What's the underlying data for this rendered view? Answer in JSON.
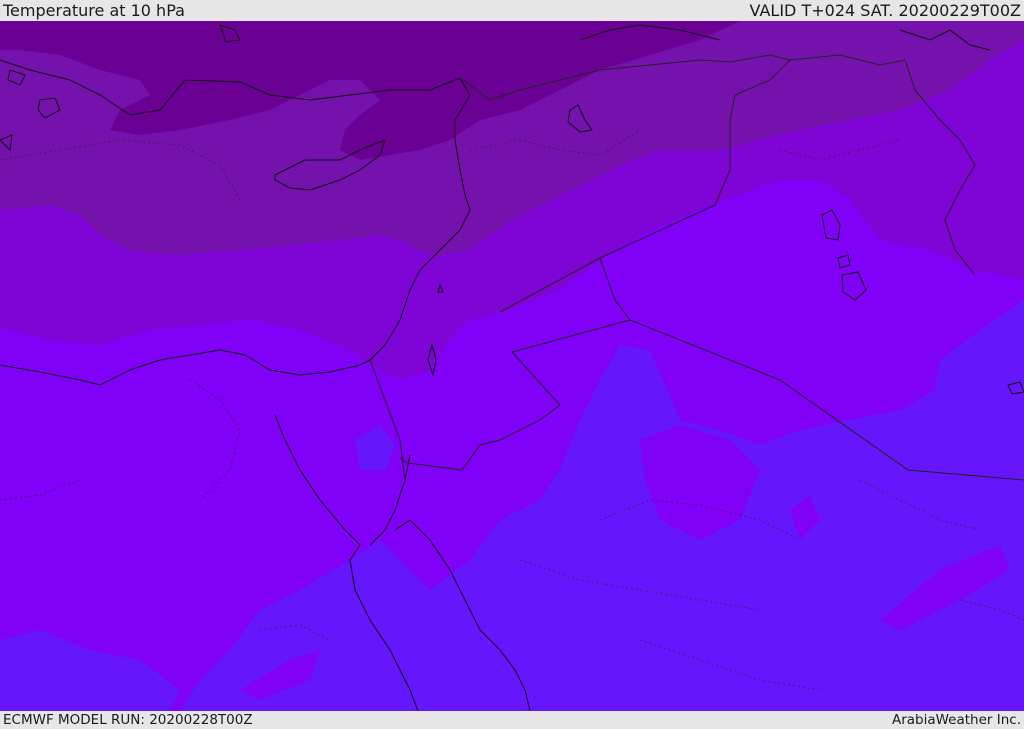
{
  "header": {
    "title": "Temperature at 10 hPa",
    "valid_time": "VALID T+024 SAT. 20200229T00Z"
  },
  "footer": {
    "model_run": "ECMWF MODEL RUN: 20200228T00Z",
    "credit": "ArabiaWeather Inc."
  },
  "map": {
    "field": "temperature",
    "level": "10 hPa",
    "colors": {
      "darkest": "#6a0094",
      "dark": "#7512ad",
      "mid": "#7e05d6",
      "violet": "#8000f8",
      "blue_violet": "#6616fc",
      "coastline": "#111111",
      "border": "#222222"
    }
  }
}
